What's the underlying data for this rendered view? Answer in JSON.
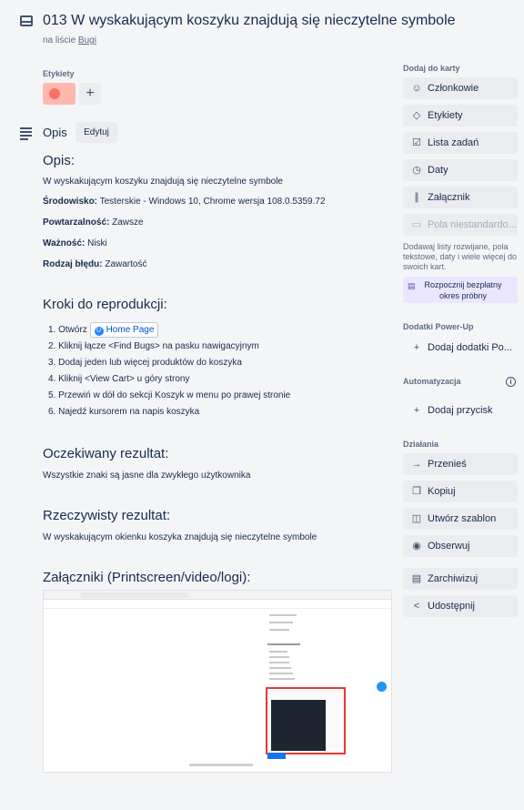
{
  "card": {
    "title": "013 W wyskakującym koszyku znajdują się nieczytelne symbole",
    "list_prefix": "na liście",
    "list_name": "Bugi"
  },
  "labels": {
    "heading": "Etykiety",
    "add": "+",
    "chip_color": "#f87168"
  },
  "description": {
    "heading": "Opis",
    "edit_label": "Edytuj",
    "opis_h": "Opis:",
    "opis_text": "W wyskakującym koszyku znajdują się nieczytelne symbole",
    "env_label": "Środowisko:",
    "env_value": " Testerskie - Windows 10, Chrome wersja 108.0.5359.72",
    "repeat_label": "Powtarzalność:",
    "repeat_value": " Zawsze",
    "severity_label": "Ważność:",
    "severity_value": " Niski",
    "type_label": "Rodzaj błędu:",
    "type_value": " Zawartość",
    "steps_h": "Kroki do reprodukcji:",
    "steps": [
      "1. Otwórz",
      "2. Kliknij łącze <Find Bugs> na pasku nawigacyjnym",
      "3. Dodaj jeden lub więcej produktów do koszyka",
      "4. Kliknij <View Cart> u góry strony",
      "5. Przewiń w dół do sekcji Koszyk w menu po prawej stronie",
      "6. Najedź kursorem na napis koszyka"
    ],
    "home_link": "Home Page",
    "expected_h": "Oczekiwany rezultat:",
    "expected_text": "Wszystkie znaki są jasne dla zwykłego użytkownika",
    "actual_h": "Rzeczywisty rezultat:",
    "actual_text": "W wyskakującym okienku koszyka znajdują się nieczytelne symbole",
    "attachments_h": "Załączniki (Printscreen/video/logi):"
  },
  "sidebar": {
    "add_heading": "Dodaj do karty",
    "members": "Członkowie",
    "labels": "Etykiety",
    "checklist": "Lista zadań",
    "dates": "Daty",
    "attachment": "Załącznik",
    "custom_fields": "Pola niestandardo...",
    "note": "Dodawaj listy rozwijane, pola tekstowe, daty i wiele więcej do swoich kart.",
    "trial": "Rozpocznij bezpłatny okres próbny",
    "powerups_heading": "Dodatki Power-Up",
    "add_powerups": "Dodaj dodatki Po...",
    "automation_heading": "Automatyzacja",
    "add_button": "Dodaj przycisk",
    "actions_heading": "Działania",
    "move": "Przenieś",
    "copy": "Kopiuj",
    "template": "Utwórz szablon",
    "watch": "Obserwuj",
    "archive": "Zarchiwizuj",
    "share": "Udostępnij"
  }
}
